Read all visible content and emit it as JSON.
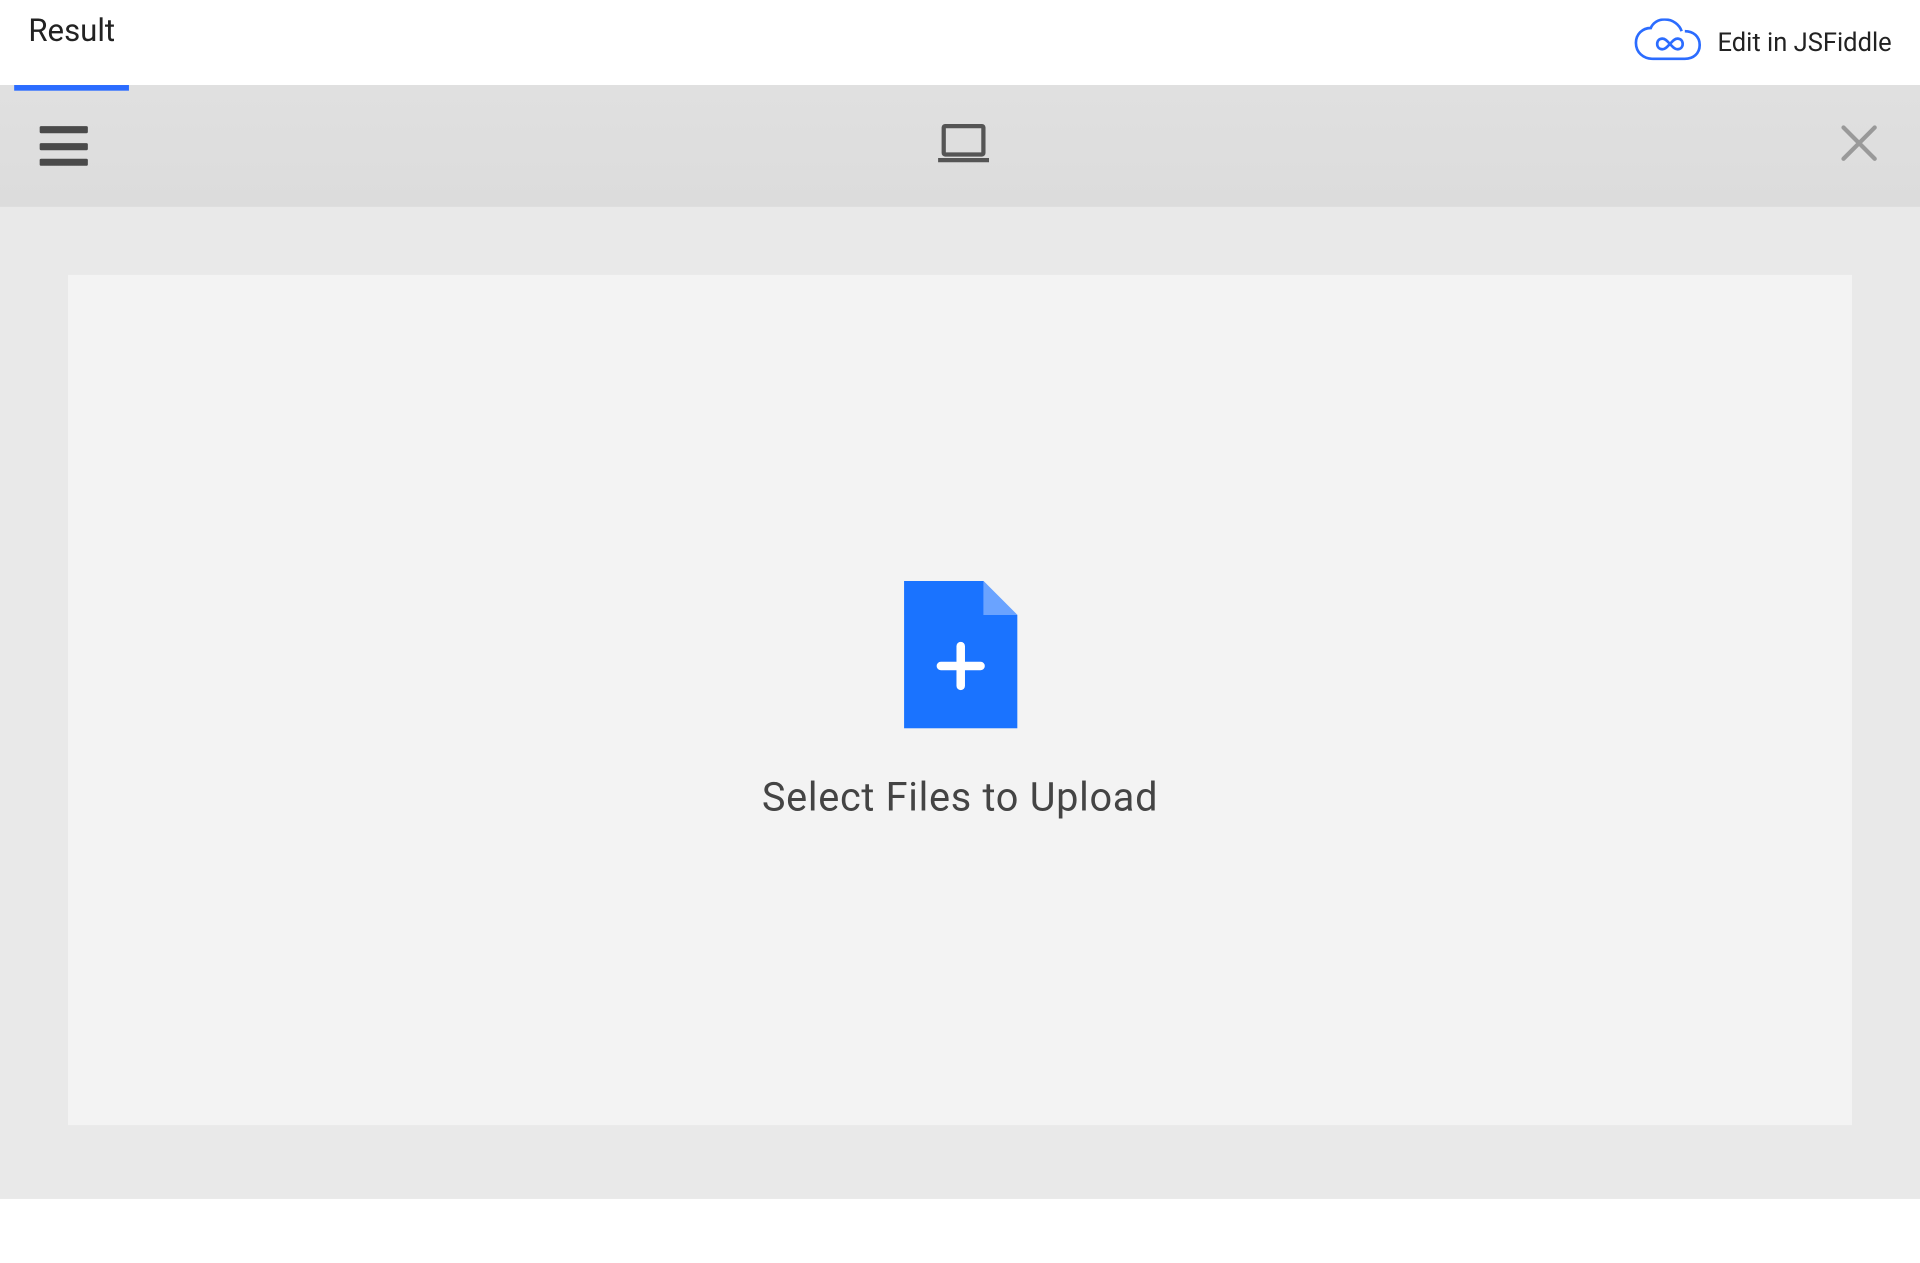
{
  "header": {
    "tab_label": "Result",
    "edit_link_label": "Edit in JSFiddle"
  },
  "picker": {
    "drop_label": "Select Files to Upload"
  },
  "colors": {
    "accent": "#2b6cff",
    "file_icon": "#1a73ff"
  }
}
